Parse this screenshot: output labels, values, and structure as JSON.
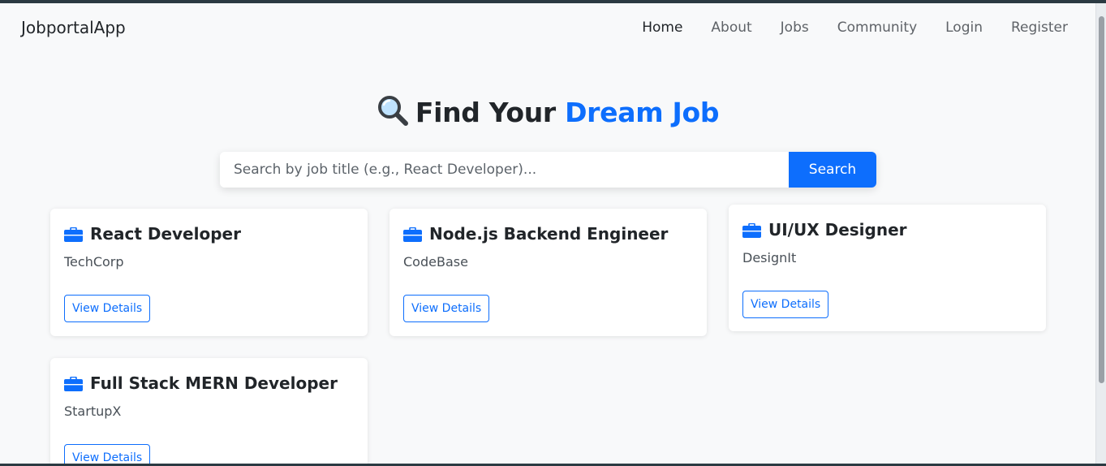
{
  "navbar": {
    "brand": "JobportalApp",
    "links": [
      {
        "label": "Home",
        "active": true
      },
      {
        "label": "About",
        "active": false
      },
      {
        "label": "Jobs",
        "active": false
      },
      {
        "label": "Community",
        "active": false
      },
      {
        "label": "Login",
        "active": false
      },
      {
        "label": "Register",
        "active": false
      }
    ]
  },
  "hero": {
    "icon": "magnifying-glass-icon",
    "title_prefix": "Find Your ",
    "title_accent": "Dream Job"
  },
  "search": {
    "placeholder": "Search by job title (e.g., React Developer)...",
    "value": "",
    "button_label": "Search"
  },
  "jobs": [
    {
      "title": "React Developer",
      "company": "TechCorp",
      "button_label": "View Details",
      "icon": "briefcase-icon"
    },
    {
      "title": "Node.js Backend Engineer",
      "company": "CodeBase",
      "button_label": "View Details",
      "icon": "briefcase-icon"
    },
    {
      "title": "UI/UX Designer",
      "company": "DesignIt",
      "button_label": "View Details",
      "icon": "briefcase-icon"
    },
    {
      "title": "Full Stack MERN Developer",
      "company": "StartupX",
      "button_label": "View Details",
      "icon": "briefcase-icon"
    }
  ],
  "colors": {
    "primary": "#0d6efd",
    "background": "#f8f9fa",
    "text": "#212529"
  }
}
